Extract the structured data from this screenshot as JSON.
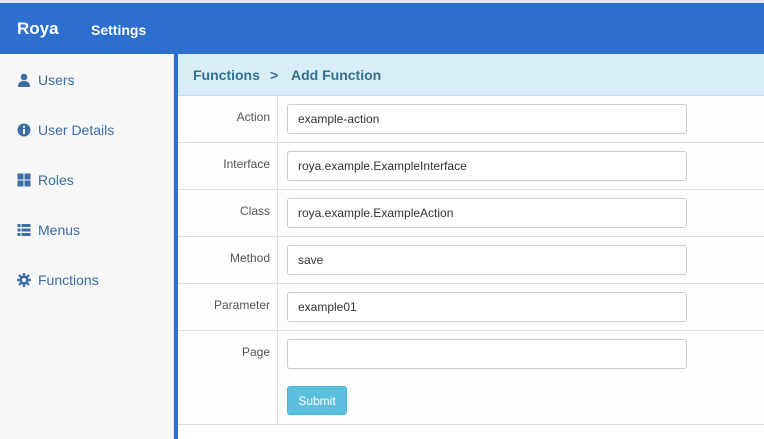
{
  "app": {
    "brand": "Roya",
    "nav_settings": "Settings"
  },
  "sidebar": {
    "items": [
      {
        "label": "Users",
        "icon": "user-icon"
      },
      {
        "label": "User Details",
        "icon": "info-circle-icon"
      },
      {
        "label": "Roles",
        "icon": "th-large-icon"
      },
      {
        "label": "Menus",
        "icon": "list-icon"
      },
      {
        "label": "Functions",
        "icon": "gear-icon"
      }
    ]
  },
  "breadcrumb": {
    "parent": "Functions",
    "separator": ">",
    "current": "Add Function"
  },
  "form": {
    "fields": [
      {
        "label": "Action",
        "value": "example-action"
      },
      {
        "label": "Interface",
        "value": "roya.example.ExampleInterface"
      },
      {
        "label": "Class",
        "value": "roya.example.ExampleAction"
      },
      {
        "label": "Method",
        "value": "save"
      },
      {
        "label": "Parameter",
        "value": "example01"
      },
      {
        "label": "Page",
        "value": ""
      }
    ],
    "submit_label": "Submit"
  },
  "colors": {
    "primary": "#2d6ecf",
    "link": "#3a6ea5",
    "breadcrumb_bg": "#d9edf7",
    "submit_bg": "#5bc0de"
  }
}
